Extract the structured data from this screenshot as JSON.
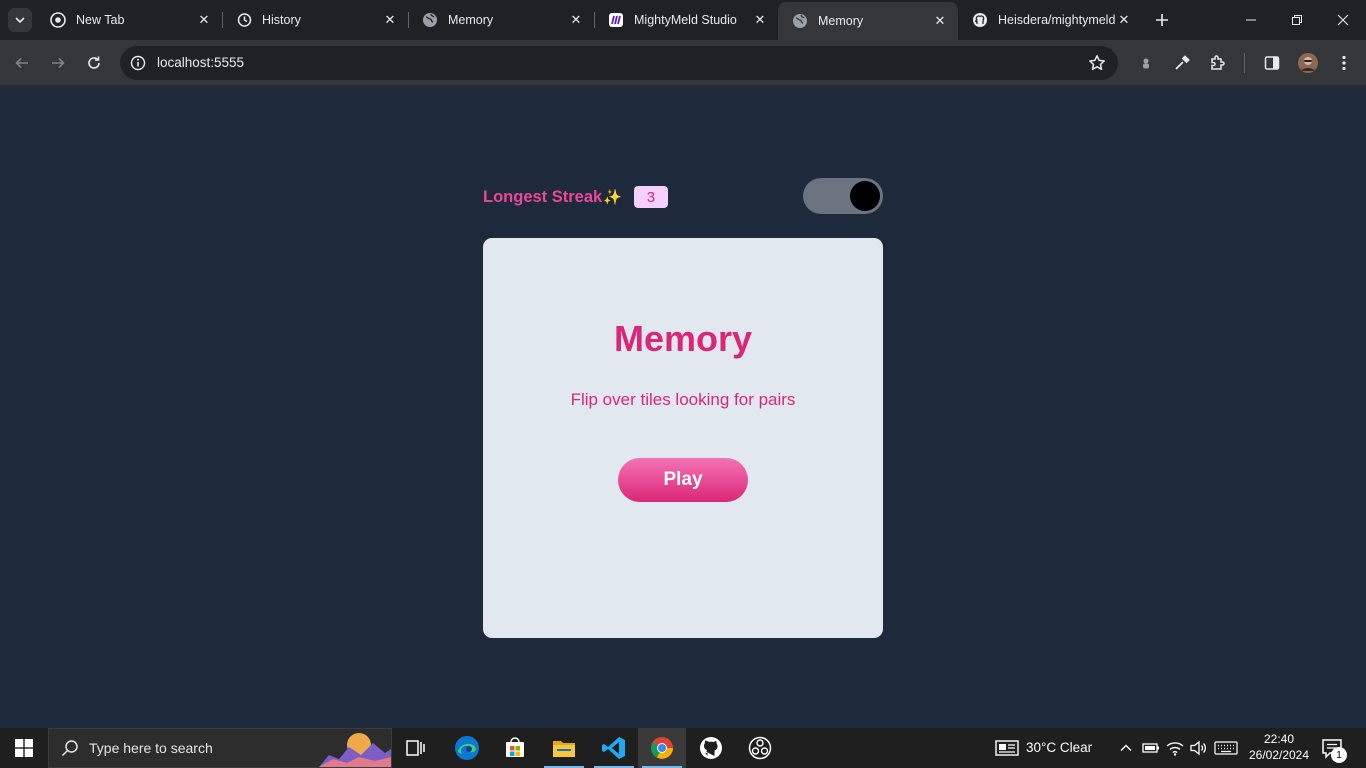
{
  "browser": {
    "tabs": [
      {
        "title": "New Tab",
        "icon": "chrome-icon",
        "active": false
      },
      {
        "title": "History",
        "icon": "history-icon",
        "active": false
      },
      {
        "title": "Memory",
        "icon": "globe-icon",
        "active": false
      },
      {
        "title": "MightyMeld Studio",
        "icon": "mightymeld-icon",
        "active": false
      },
      {
        "title": "Memory",
        "icon": "globe-icon",
        "active": true
      },
      {
        "title": "Heisdera/mightymeld",
        "icon": "github-icon",
        "active": false
      }
    ],
    "address_bar": {
      "url": "localhost:5555"
    }
  },
  "page": {
    "streak_label": "Longest Streak",
    "streak_emoji": "✨",
    "streak_value": "3",
    "theme_toggle_on": true,
    "card": {
      "title": "Memory",
      "subtitle": "Flip over tiles looking for pairs",
      "play_label": "Play"
    },
    "colors": {
      "accent": "#db2777",
      "accent_light": "#ec4899",
      "background": "#1e293b",
      "card": "#e2e8f0"
    }
  },
  "taskbar": {
    "search_placeholder": "Type here to search",
    "weather": "30°C  Clear",
    "time": "22:40",
    "date": "26/02/2024",
    "notification_count": "1",
    "pinned_apps": [
      "task-view-icon",
      "edge-icon",
      "store-icon",
      "file-explorer-icon",
      "vscode-icon",
      "chrome-icon",
      "github-desktop-icon",
      "obs-icon"
    ]
  }
}
